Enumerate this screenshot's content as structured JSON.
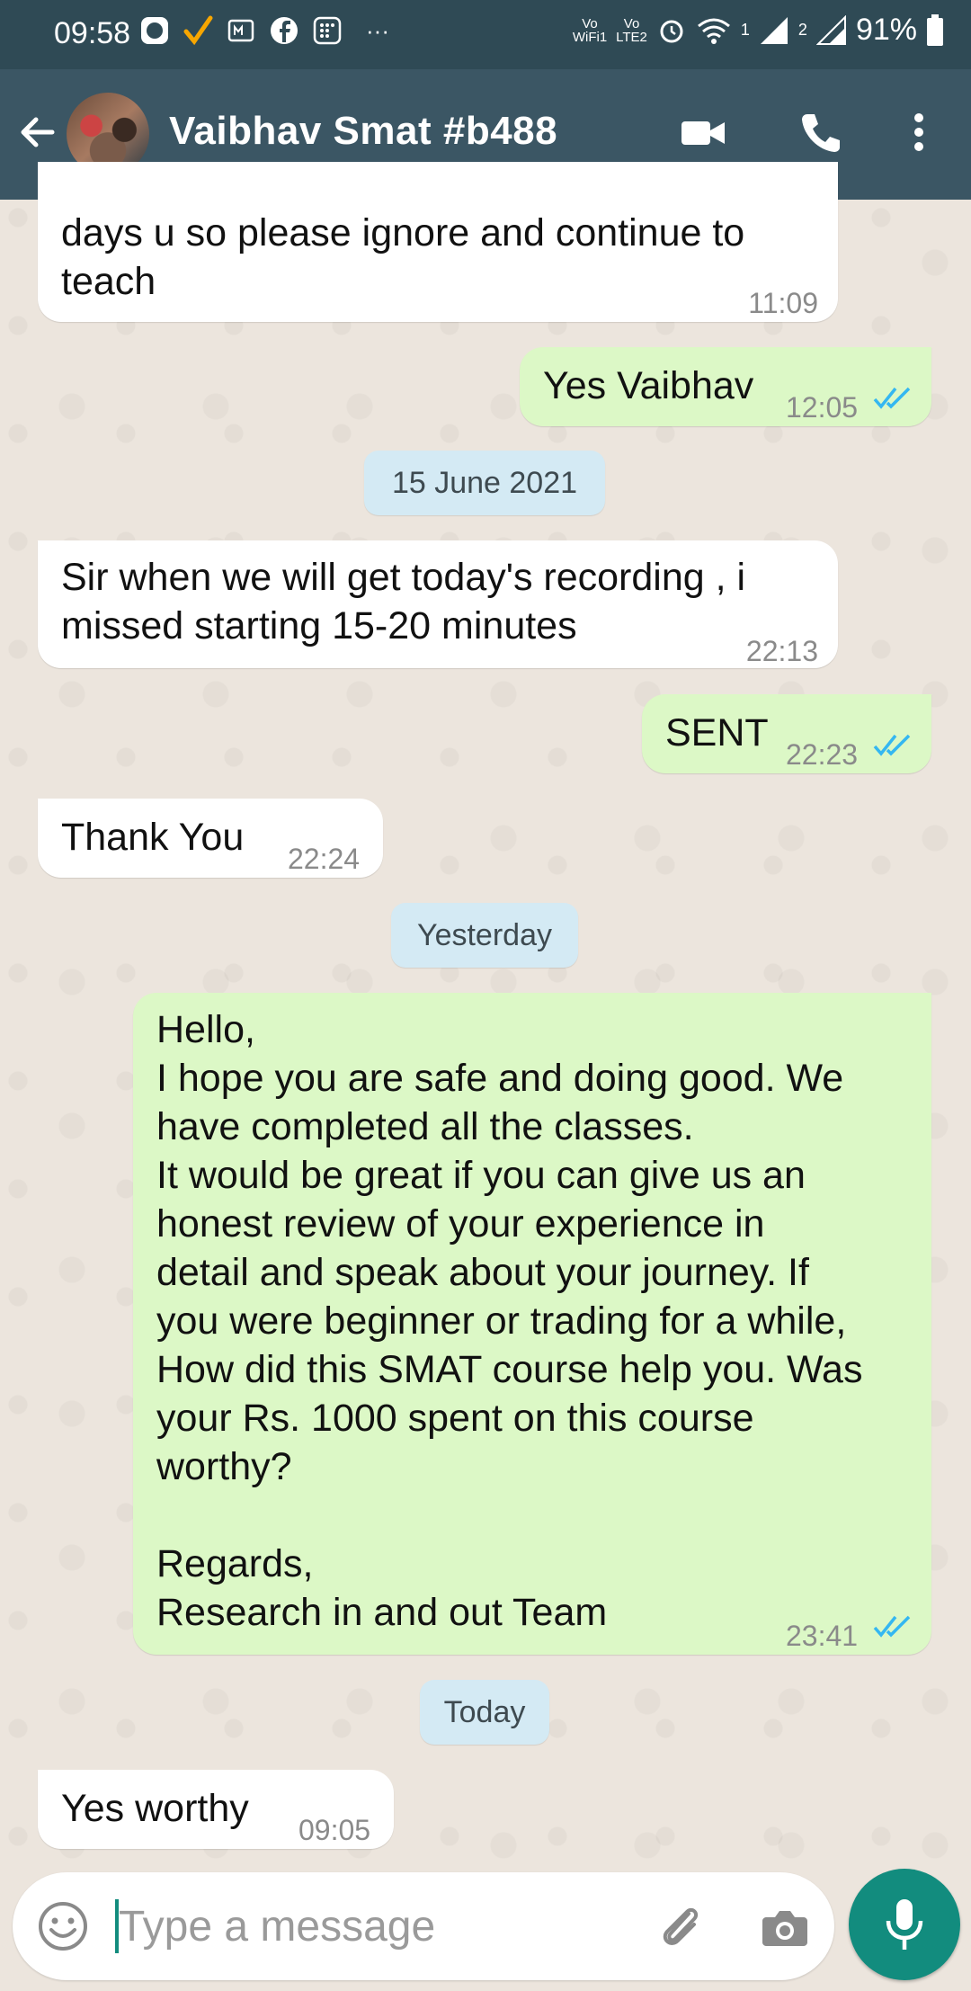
{
  "status_bar": {
    "time": "09:58",
    "volte1": "Vo\nWiFi1",
    "volte2": "Vo\nLTE2",
    "sim1": "1",
    "sim2": "2",
    "battery": "91%"
  },
  "header": {
    "title": "Vaibhav Smat #b488"
  },
  "messages": [
    {
      "text": "days u so please ignore and continue to\nteach",
      "time": "11:09",
      "direction": "in"
    },
    {
      "text": "Yes Vaibhav",
      "time": "12:05",
      "direction": "out",
      "status": "read"
    },
    {
      "text": "Sir when we will get today's recording , i\nmissed starting 15-20 minutes",
      "time": "22:13",
      "direction": "in"
    },
    {
      "text": "SENT",
      "time": "22:23",
      "direction": "out",
      "status": "read"
    },
    {
      "text": "Thank You",
      "time": "22:24",
      "direction": "in"
    },
    {
      "text": "Hello,\nI hope you are safe and doing good. We\nhave completed all the classes.\nIt would be great if you can give us an\nhonest review of your experience in\ndetail and speak about your journey. If\nyou were beginner or trading for a while,\nHow did this SMAT course help you. Was\nyour Rs. 1000 spent on this course\nworthy?\n\nRegards,\nResearch in and out Team",
      "time": "23:41",
      "direction": "out",
      "status": "read"
    },
    {
      "text": "Yes worthy",
      "time": "09:05",
      "direction": "in"
    }
  ],
  "date_separators": [
    "15 June 2021",
    "Yesterday",
    "Today"
  ],
  "composer": {
    "placeholder": "Type a message",
    "value": ""
  },
  "colors": {
    "app_bar": "#3b5664",
    "status_bar": "#2f4a55",
    "outgoing_bubble": "#dcf8c6",
    "incoming_bubble": "#ffffff",
    "date_chip": "#d4eaf4",
    "accent": "#128c7e",
    "read_tick": "#34b7f1"
  },
  "icons": [
    "back-arrow-icon",
    "video-call-icon",
    "voice-call-icon",
    "more-options-icon",
    "emoji-icon",
    "attach-icon",
    "camera-icon",
    "mic-icon",
    "double-tick-icon"
  ]
}
